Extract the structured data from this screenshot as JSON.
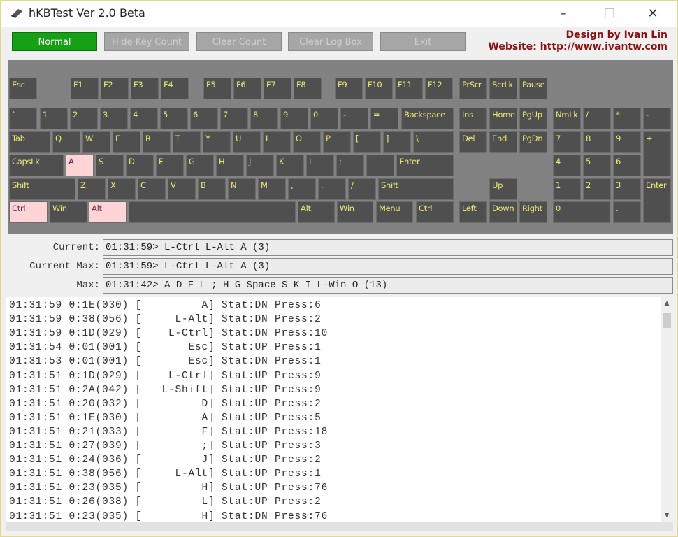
{
  "window": {
    "title": "hKBTest Ver 2.0 Beta",
    "minimize": "–",
    "maximize": "☐",
    "close": "✕"
  },
  "toolbar": {
    "buttons": [
      {
        "label": "Normal",
        "state": "active"
      },
      {
        "label": "Hide Key Count",
        "state": "disabled"
      },
      {
        "label": "Clear Count",
        "state": "disabled"
      },
      {
        "label": "Clear Log Box",
        "state": "disabled"
      },
      {
        "label": "Exit",
        "state": "disabled"
      }
    ],
    "credit_line1": "Design by Ivan Lin",
    "credit_line2": "Website: http://www.ivantw.com"
  },
  "colors": {
    "key": "#4f4f4f",
    "key_label": "#eaea78",
    "pressed": "#ffd4d6",
    "panel": "#828282",
    "active_button": "#15a015",
    "credit": "#8b1010"
  },
  "keyboard": {
    "keys": [
      {
        "label": "Esc"
      },
      {
        "label": "F1"
      },
      {
        "label": "F2"
      },
      {
        "label": "F3"
      },
      {
        "label": "F4"
      },
      {
        "label": "F5"
      },
      {
        "label": "F6"
      },
      {
        "label": "F7"
      },
      {
        "label": "F8"
      },
      {
        "label": "F9"
      },
      {
        "label": "F10"
      },
      {
        "label": "F11"
      },
      {
        "label": "F12"
      },
      {
        "label": "PrScr"
      },
      {
        "label": "ScrLk"
      },
      {
        "label": "Pause"
      },
      {
        "label": "`"
      },
      {
        "label": "1"
      },
      {
        "label": "2"
      },
      {
        "label": "3"
      },
      {
        "label": "4"
      },
      {
        "label": "5"
      },
      {
        "label": "6"
      },
      {
        "label": "7"
      },
      {
        "label": "8"
      },
      {
        "label": "9"
      },
      {
        "label": "0"
      },
      {
        "label": "-"
      },
      {
        "label": "="
      },
      {
        "label": "Backspace"
      },
      {
        "label": "Ins"
      },
      {
        "label": "Home"
      },
      {
        "label": "PgUp"
      },
      {
        "label": "NmLk"
      },
      {
        "label": "/"
      },
      {
        "label": "*"
      },
      {
        "label": "-"
      },
      {
        "label": "Tab"
      },
      {
        "label": "Q"
      },
      {
        "label": "W"
      },
      {
        "label": "E"
      },
      {
        "label": "R"
      },
      {
        "label": "T"
      },
      {
        "label": "Y"
      },
      {
        "label": "U"
      },
      {
        "label": "I"
      },
      {
        "label": "O"
      },
      {
        "label": "P"
      },
      {
        "label": "["
      },
      {
        "label": "]"
      },
      {
        "label": "\\"
      },
      {
        "label": "Del"
      },
      {
        "label": "End"
      },
      {
        "label": "PgDn"
      },
      {
        "label": "7"
      },
      {
        "label": "8"
      },
      {
        "label": "9"
      },
      {
        "label": "+"
      },
      {
        "label": "CapsLk"
      },
      {
        "label": "A",
        "pressed": true
      },
      {
        "label": "S"
      },
      {
        "label": "D"
      },
      {
        "label": "F"
      },
      {
        "label": "G"
      },
      {
        "label": "H"
      },
      {
        "label": "J"
      },
      {
        "label": "K"
      },
      {
        "label": "L"
      },
      {
        "label": ";"
      },
      {
        "label": "'"
      },
      {
        "label": "Enter"
      },
      {
        "label": "4"
      },
      {
        "label": "5"
      },
      {
        "label": "6"
      },
      {
        "label": "Shift"
      },
      {
        "label": "Z"
      },
      {
        "label": "X"
      },
      {
        "label": "C"
      },
      {
        "label": "V"
      },
      {
        "label": "B"
      },
      {
        "label": "N"
      },
      {
        "label": "M"
      },
      {
        "label": ","
      },
      {
        "label": "."
      },
      {
        "label": "/"
      },
      {
        "label": "Shift"
      },
      {
        "label": "Up"
      },
      {
        "label": "1"
      },
      {
        "label": "2"
      },
      {
        "label": "3"
      },
      {
        "label": "Enter"
      },
      {
        "label": "Ctrl",
        "pressed": true
      },
      {
        "label": "Win"
      },
      {
        "label": "Alt",
        "pressed": true
      },
      {
        "label": ""
      },
      {
        "label": "Alt"
      },
      {
        "label": "Win"
      },
      {
        "label": "Menu"
      },
      {
        "label": "Ctrl"
      },
      {
        "label": "Left"
      },
      {
        "label": "Down"
      },
      {
        "label": "Right"
      },
      {
        "label": "0"
      },
      {
        "label": "."
      }
    ]
  },
  "status": {
    "current_label": "Current:",
    "current_value": "01:31:59> L-Ctrl L-Alt A (3)",
    "current_max_label": "Current Max:",
    "current_max_value": "01:31:59> L-Ctrl L-Alt A (3)",
    "max_label": "Max:",
    "max_value": "01:31:42> A D F L ; H G Space S K I L-Win O (13)"
  },
  "log": [
    "01:31:59 0:1E(030) [         A] Stat:DN Press:6",
    "01:31:59 0:38(056) [     L-Alt] Stat:DN Press:2",
    "01:31:59 0:1D(029) [    L-Ctrl] Stat:DN Press:10",
    "01:31:54 0:01(001) [       Esc] Stat:UP Press:1",
    "01:31:53 0:01(001) [       Esc] Stat:DN Press:1",
    "01:31:51 0:1D(029) [    L-Ctrl] Stat:UP Press:9",
    "01:31:51 0:2A(042) [   L-Shift] Stat:UP Press:9",
    "01:31:51 0:20(032) [         D] Stat:UP Press:2",
    "01:31:51 0:1E(030) [         A] Stat:UP Press:5",
    "01:31:51 0:21(033) [         F] Stat:UP Press:18",
    "01:31:51 0:27(039) [         ;] Stat:UP Press:3",
    "01:31:51 0:24(036) [         J] Stat:UP Press:2",
    "01:31:51 0:38(056) [     L-Alt] Stat:UP Press:1",
    "01:31:51 0:23(035) [         H] Stat:UP Press:76",
    "01:31:51 0:26(038) [         L] Stat:UP Press:2",
    "01:31:51 0:23(035) [         H] Stat:DN Press:76"
  ],
  "scrollbar": {
    "up": "▲",
    "down": "▼"
  }
}
